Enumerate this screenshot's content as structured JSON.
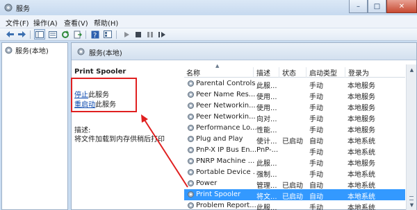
{
  "window": {
    "title": "服务"
  },
  "menu": [
    {
      "label": "文件(F)"
    },
    {
      "label": "操作(A)"
    },
    {
      "label": "查看(V)"
    },
    {
      "label": "帮助(H)"
    }
  ],
  "tree": {
    "label": "服务(本地)"
  },
  "pane": {
    "header": "服务(本地)"
  },
  "details": {
    "service_name": "Print Spooler",
    "stop_link": "停止",
    "stop_suffix": "此服务",
    "restart_link": "重启动",
    "restart_suffix": "此服务",
    "desc_label": "描述:",
    "desc_text": "将文件加载到内存供稍后打印"
  },
  "list": {
    "columns": {
      "name": "名称",
      "desc": "描述",
      "status": "状态",
      "startup": "启动类型",
      "logon": "登录为"
    },
    "rows": [
      {
        "name": "Parental Controls",
        "desc": "此服...",
        "status": "",
        "startup": "手动",
        "logon": "本地服务",
        "selected": false
      },
      {
        "name": "Peer Name Res...",
        "desc": "使用...",
        "status": "",
        "startup": "手动",
        "logon": "本地服务",
        "selected": false
      },
      {
        "name": "Peer Networkin...",
        "desc": "使用...",
        "status": "",
        "startup": "手动",
        "logon": "本地服务",
        "selected": false
      },
      {
        "name": "Peer Networkin...",
        "desc": "向对...",
        "status": "",
        "startup": "手动",
        "logon": "本地服务",
        "selected": false
      },
      {
        "name": "Performance Lo...",
        "desc": "性能...",
        "status": "",
        "startup": "手动",
        "logon": "本地服务",
        "selected": false
      },
      {
        "name": "Plug and Play",
        "desc": "使计...",
        "status": "已启动",
        "startup": "自动",
        "logon": "本地系统",
        "selected": false
      },
      {
        "name": "PnP-X IP Bus En...",
        "desc": "PnP-...",
        "status": "",
        "startup": "手动",
        "logon": "本地系统",
        "selected": false
      },
      {
        "name": "PNRP Machine ...",
        "desc": "此服...",
        "status": "",
        "startup": "手动",
        "logon": "本地服务",
        "selected": false
      },
      {
        "name": "Portable Device ...",
        "desc": "强制...",
        "status": "",
        "startup": "手动",
        "logon": "本地系统",
        "selected": false
      },
      {
        "name": "Power",
        "desc": "管理...",
        "status": "已启动",
        "startup": "自动",
        "logon": "本地系统",
        "selected": false
      },
      {
        "name": "Print Spooler",
        "desc": "将文...",
        "status": "已启动",
        "startup": "自动",
        "logon": "本地系统",
        "selected": true
      },
      {
        "name": "Problem Report...",
        "desc": "此服...",
        "status": "",
        "startup": "手动",
        "logon": "本地系统",
        "selected": false
      }
    ]
  },
  "colors": {
    "selection": "#3399ff",
    "annotation": "#e02020",
    "link": "#0645ad"
  }
}
